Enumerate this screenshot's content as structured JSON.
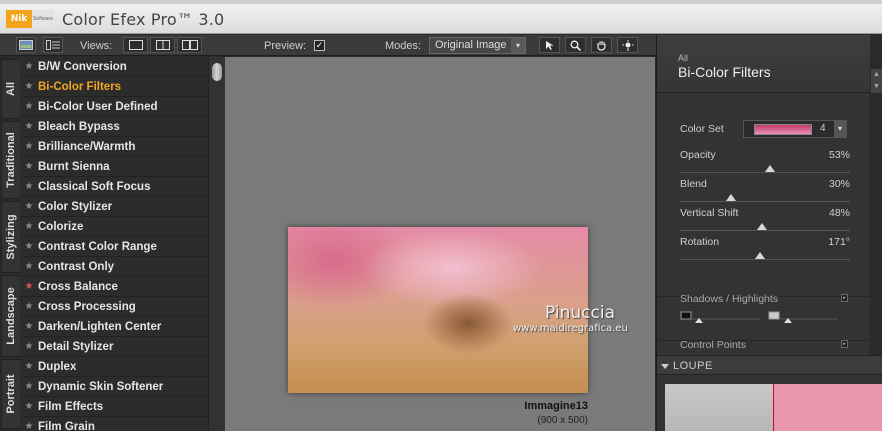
{
  "app": {
    "logo_text": "Nik",
    "logo_sub": "Software",
    "title": "Color Efex Pro™ 3.0"
  },
  "toolbar": {
    "views_label": "Views:",
    "preview_label": "Preview:",
    "preview_checked": "✓",
    "modes_label": "Modes:",
    "mode_value": "Original Image",
    "dropdown_glyph": "▾"
  },
  "vertical_tabs": [
    "All",
    "Traditional",
    "Stylizing",
    "Landscape",
    "Portrait"
  ],
  "filters": [
    {
      "name": "B/W Conversion",
      "star": "★"
    },
    {
      "name": "Bi-Color Filters",
      "star": "★",
      "active": true
    },
    {
      "name": "Bi-Color User Defined",
      "star": "★"
    },
    {
      "name": "Bleach Bypass",
      "star": "★"
    },
    {
      "name": "Brilliance/Warmth",
      "star": "★"
    },
    {
      "name": "Burnt Sienna",
      "star": "★"
    },
    {
      "name": "Classical Soft Focus",
      "star": "★"
    },
    {
      "name": "Color Stylizer",
      "star": "★"
    },
    {
      "name": "Colorize",
      "star": "★"
    },
    {
      "name": "Contrast Color Range",
      "star": "★"
    },
    {
      "name": "Contrast Only",
      "star": "★"
    },
    {
      "name": "Cross Balance",
      "star": "★",
      "red": true
    },
    {
      "name": "Cross Processing",
      "star": "★"
    },
    {
      "name": "Darken/Lighten Center",
      "star": "★"
    },
    {
      "name": "Detail Stylizer",
      "star": "★"
    },
    {
      "name": "Duplex",
      "star": "★"
    },
    {
      "name": "Dynamic Skin Softener",
      "star": "★"
    },
    {
      "name": "Film Effects",
      "star": "★"
    },
    {
      "name": "Film Grain",
      "star": "★"
    }
  ],
  "preview": {
    "watermark_name": "Pinuccia",
    "watermark_url": "www.maidiregrafica.eu",
    "image_name": "Immagine13",
    "image_size": "(900 x 500)"
  },
  "panel": {
    "category": "All",
    "title": "Bi-Color Filters",
    "color_set_label": "Color Set",
    "color_set_value": "4",
    "params": [
      {
        "label": "Opacity",
        "value": "53%",
        "level": 0.53
      },
      {
        "label": "Blend",
        "value": "30%",
        "level": 0.3
      },
      {
        "label": "Vertical Shift",
        "value": "48%",
        "level": 0.48
      },
      {
        "label": "Rotation",
        "value": "171°",
        "level": 0.47
      }
    ],
    "shadows_label": "Shadows / Highlights",
    "control_points_label": "Control Points",
    "loupe_label": "LOUPE",
    "scroll_up": "▲",
    "scroll_down": "▼",
    "expand_glyph": "▸"
  },
  "colors": {
    "accent": "#f3a524",
    "panel_bg": "#333333",
    "preview_bg": "#7a7a7a"
  }
}
